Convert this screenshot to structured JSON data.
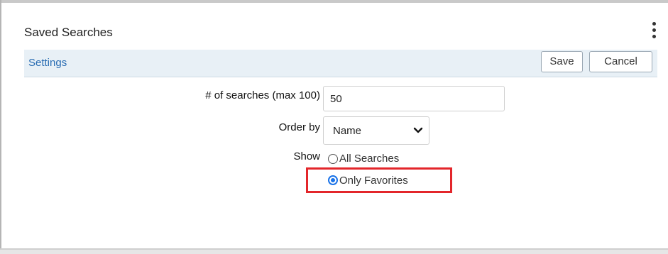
{
  "panel": {
    "title": "Saved Searches",
    "menu_icon": "more-vertical-icon"
  },
  "settings": {
    "label": "Settings",
    "save_label": "Save",
    "cancel_label": "Cancel"
  },
  "form": {
    "count_label": "# of searches (max 100)",
    "count_value": "50",
    "order_label": "Order by",
    "order_value": "Name",
    "show_label": "Show",
    "show_options": [
      {
        "label": "All Searches",
        "selected": false
      },
      {
        "label": "Only Favorites",
        "selected": true
      }
    ]
  },
  "annotation": {
    "highlight_color": "#e3262b"
  },
  "colors": {
    "link": "#2a6db3",
    "settings_bar_bg": "#e8f0f6",
    "radio_selected": "#1a73e8"
  }
}
